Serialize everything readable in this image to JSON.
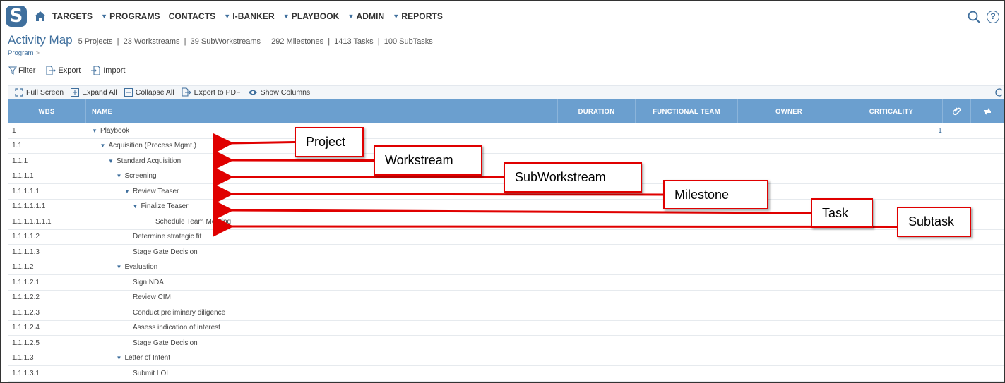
{
  "nav": {
    "logo": "S",
    "items": [
      {
        "label": "TARGETS",
        "chevron": false
      },
      {
        "label": "PROGRAMS",
        "chevron": true
      },
      {
        "label": "CONTACTS",
        "chevron": false
      },
      {
        "label": "I-BANKER",
        "chevron": true
      },
      {
        "label": "PLAYBOOK",
        "chevron": true
      },
      {
        "label": "ADMIN",
        "chevron": true
      },
      {
        "label": "REPORTS",
        "chevron": true
      }
    ],
    "help": "?"
  },
  "header": {
    "title": "Activity Map",
    "stats": "5 Projects  |  23 Workstreams  |  39 SubWorkstreams  |  292 Milestones  |  1413 Tasks  |  100 SubTasks",
    "breadcrumb": "Program",
    "breadcrumb_sep": ">"
  },
  "actions": {
    "filter": "Filter",
    "export": "Export",
    "import": "Import"
  },
  "toolbar": {
    "full_screen": "Full Screen",
    "expand_all": "Expand All",
    "collapse_all": "Collapse All",
    "export_pdf": "Export to PDF",
    "show_columns": "Show Columns"
  },
  "grid": {
    "columns": {
      "wbs": "WBS",
      "name": "NAME",
      "duration": "DURATION",
      "functional_team": "FUNCTIONAL TEAM",
      "owner": "OWNER",
      "criticality": "CRITICALITY"
    },
    "rows": [
      {
        "wbs": "1",
        "name": "Playbook",
        "level": 0,
        "expanded": true,
        "attachments": "1"
      },
      {
        "wbs": "1.1",
        "name": "Acquisition (Process Mgmt.)",
        "level": 1,
        "expanded": true,
        "attachments": ""
      },
      {
        "wbs": "1.1.1",
        "name": "Standard Acquisition",
        "level": 2,
        "expanded": true,
        "attachments": ""
      },
      {
        "wbs": "1.1.1.1",
        "name": "Screening",
        "level": 3,
        "expanded": true,
        "attachments": ""
      },
      {
        "wbs": "1.1.1.1.1",
        "name": "Review Teaser",
        "level": 4,
        "expanded": true,
        "attachments": ""
      },
      {
        "wbs": "1.1.1.1.1.1",
        "name": "Finalize Teaser",
        "level": 5,
        "expanded": true,
        "attachments": ""
      },
      {
        "wbs": "1.1.1.1.1.1.1",
        "name": "Schedule Team Meeting",
        "level": 6,
        "expanded": false,
        "attachments": ""
      },
      {
        "wbs": "1.1.1.1.2",
        "name": "Determine strategic fit",
        "level": 4,
        "expanded": false,
        "attachments": ""
      },
      {
        "wbs": "1.1.1.1.3",
        "name": "Stage Gate Decision",
        "level": 4,
        "expanded": false,
        "attachments": ""
      },
      {
        "wbs": "1.1.1.2",
        "name": "Evaluation",
        "level": 3,
        "expanded": true,
        "attachments": ""
      },
      {
        "wbs": "1.1.1.2.1",
        "name": "Sign NDA",
        "level": 4,
        "expanded": false,
        "attachments": ""
      },
      {
        "wbs": "1.1.1.2.2",
        "name": "Review CIM",
        "level": 4,
        "expanded": false,
        "attachments": ""
      },
      {
        "wbs": "1.1.1.2.3",
        "name": "Conduct preliminary diligence",
        "level": 4,
        "expanded": false,
        "attachments": ""
      },
      {
        "wbs": "1.1.1.2.4",
        "name": "Assess indication of interest",
        "level": 4,
        "expanded": false,
        "attachments": ""
      },
      {
        "wbs": "1.1.1.2.5",
        "name": "Stage Gate Decision",
        "level": 4,
        "expanded": false,
        "attachments": ""
      },
      {
        "wbs": "1.1.1.3",
        "name": "Letter of Intent",
        "level": 3,
        "expanded": true,
        "attachments": ""
      },
      {
        "wbs": "1.1.1.3.1",
        "name": "Submit LOI",
        "level": 4,
        "expanded": false,
        "attachments": ""
      }
    ]
  },
  "annotations": [
    {
      "label": "Project",
      "target_row": 1
    },
    {
      "label": "Workstream",
      "target_row": 2
    },
    {
      "label": "SubWorkstream",
      "target_row": 3
    },
    {
      "label": "Milestone",
      "target_row": 4
    },
    {
      "label": "Task",
      "target_row": 5
    },
    {
      "label": "Subtask",
      "target_row": 6
    }
  ],
  "colors": {
    "brand": "#3f6f9d",
    "header_bg": "#6b9fcf",
    "annotation": "#e00000"
  }
}
